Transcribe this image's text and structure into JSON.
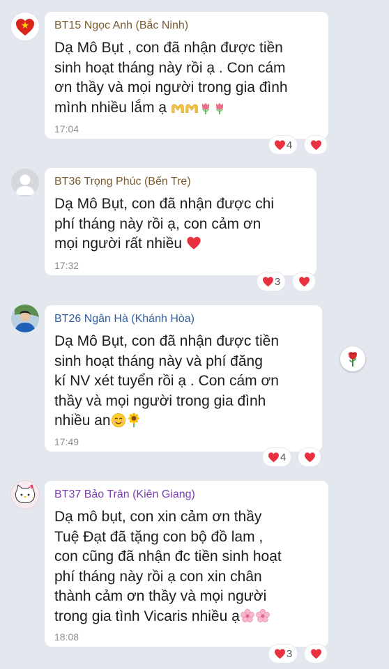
{
  "colors": {
    "background": "#e3e8ef",
    "bubble": "#ffffff",
    "heart": "#e8303f",
    "sender_1": "#7a5a2e",
    "sender_2": "#7a5a2e",
    "sender_3": "#2f5e9e",
    "sender_4": "#7b3fb0"
  },
  "messages": [
    {
      "sender": "BT15 Ngọc Anh (Bắc Ninh)",
      "text": "Dạ Mô Bụt , con đã nhận được tiền\nsinh hoạt tháng này rồi ạ . Con cám\nơn thầy và mọi người trong gia đình\nmình nhiều lắm ạ",
      "emojis": [
        "heart-hands-icon",
        "heart-hands-icon",
        "tulip-icon",
        "tulip-icon"
      ],
      "time": "17:04",
      "reaction_count": "4"
    },
    {
      "sender": "BT36 Trọng Phúc (Bến Tre)",
      "text": "Dạ Mô Bụt, con đã nhận được chi\nphí tháng này rồi ạ, con cảm ơn\nmọi người rất nhiều",
      "emojis": [
        "red-heart-icon"
      ],
      "time": "17:32",
      "reaction_count": "3"
    },
    {
      "sender": "BT26 Ngân Hà (Khánh Hòa)",
      "text": "Dạ Mô Bụt, con đã nhận được tiền\nsinh hoạt tháng này và phí đăng\nkí NV xét tuyển rồi ạ . Con cám ơn\nthầy và mọi người trong gia đình\nnhiều an",
      "emojis": [
        "smiling-face-icon",
        "sunflower-icon"
      ],
      "time": "17:49",
      "reaction_count": "4"
    },
    {
      "sender": "BT37 Bảo Trân (Kiên Giang)",
      "text": "Dạ mô bụt, con xin cảm ơn thầy\nTuệ Đạt đã tặng con bộ đồ lam ,\ncon cũng đã nhận đc tiền sinh hoạt\nphí tháng này rồi ạ con xin chân\nthành cảm ơn thầy và mọi người\ntrong gia tình Vicaris nhiều ạ",
      "emojis": [
        "cherry-blossom-icon",
        "cherry-blossom-icon"
      ],
      "time": "18:08",
      "reaction_count": "3"
    }
  ],
  "side_button_icon": "rose-icon"
}
